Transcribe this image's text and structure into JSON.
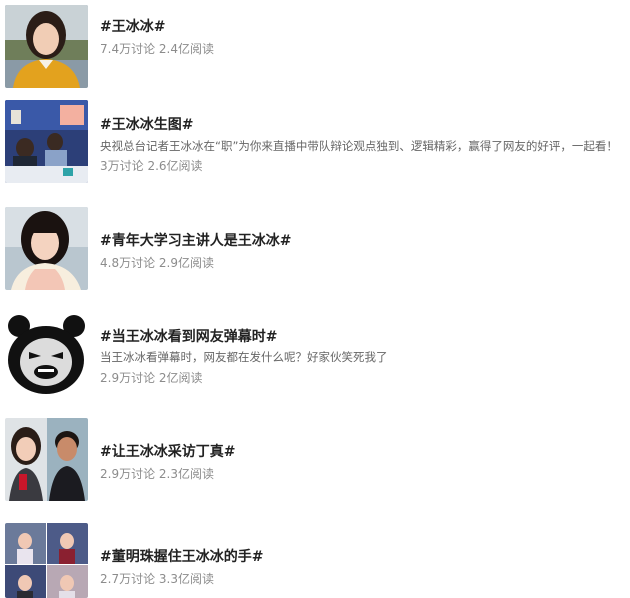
{
  "topics": [
    {
      "title": "#王冰冰#",
      "desc": "",
      "discussions": "7.4万讨论",
      "reads": "2.4亿阅读",
      "thumb_icon": "portrait-photo-icon"
    },
    {
      "title": "#王冰冰生图#",
      "desc": "央视总台记者王冰冰在“职”为你来直播中带队辩论观点独到、逻辑精彩，赢得了网友的好评，一起看！",
      "discussions": "3万讨论",
      "reads": "2.6亿阅读",
      "thumb_icon": "studio-photo-icon"
    },
    {
      "title": "#青年大学习主讲人是王冰冰#",
      "desc": "",
      "discussions": "4.8万讨论",
      "reads": "2.9亿阅读",
      "thumb_icon": "portrait-photo-icon"
    },
    {
      "title": "#当王冰冰看到网友弹幕时#",
      "desc": "当王冰冰看弹幕时，网友都在发什么呢？好家伙笑死我了",
      "discussions": "2.9万讨论",
      "reads": "2亿阅读",
      "thumb_icon": "panda-meme-icon"
    },
    {
      "title": "#让王冰冰采访丁真#",
      "desc": "",
      "discussions": "2.9万讨论",
      "reads": "2.3亿阅读",
      "thumb_icon": "two-portraits-icon"
    },
    {
      "title": "#董明珠握住王冰冰的手#",
      "desc": "",
      "discussions": "2.7万讨论",
      "reads": "3.3亿阅读",
      "thumb_icon": "photo-grid-icon"
    }
  ]
}
